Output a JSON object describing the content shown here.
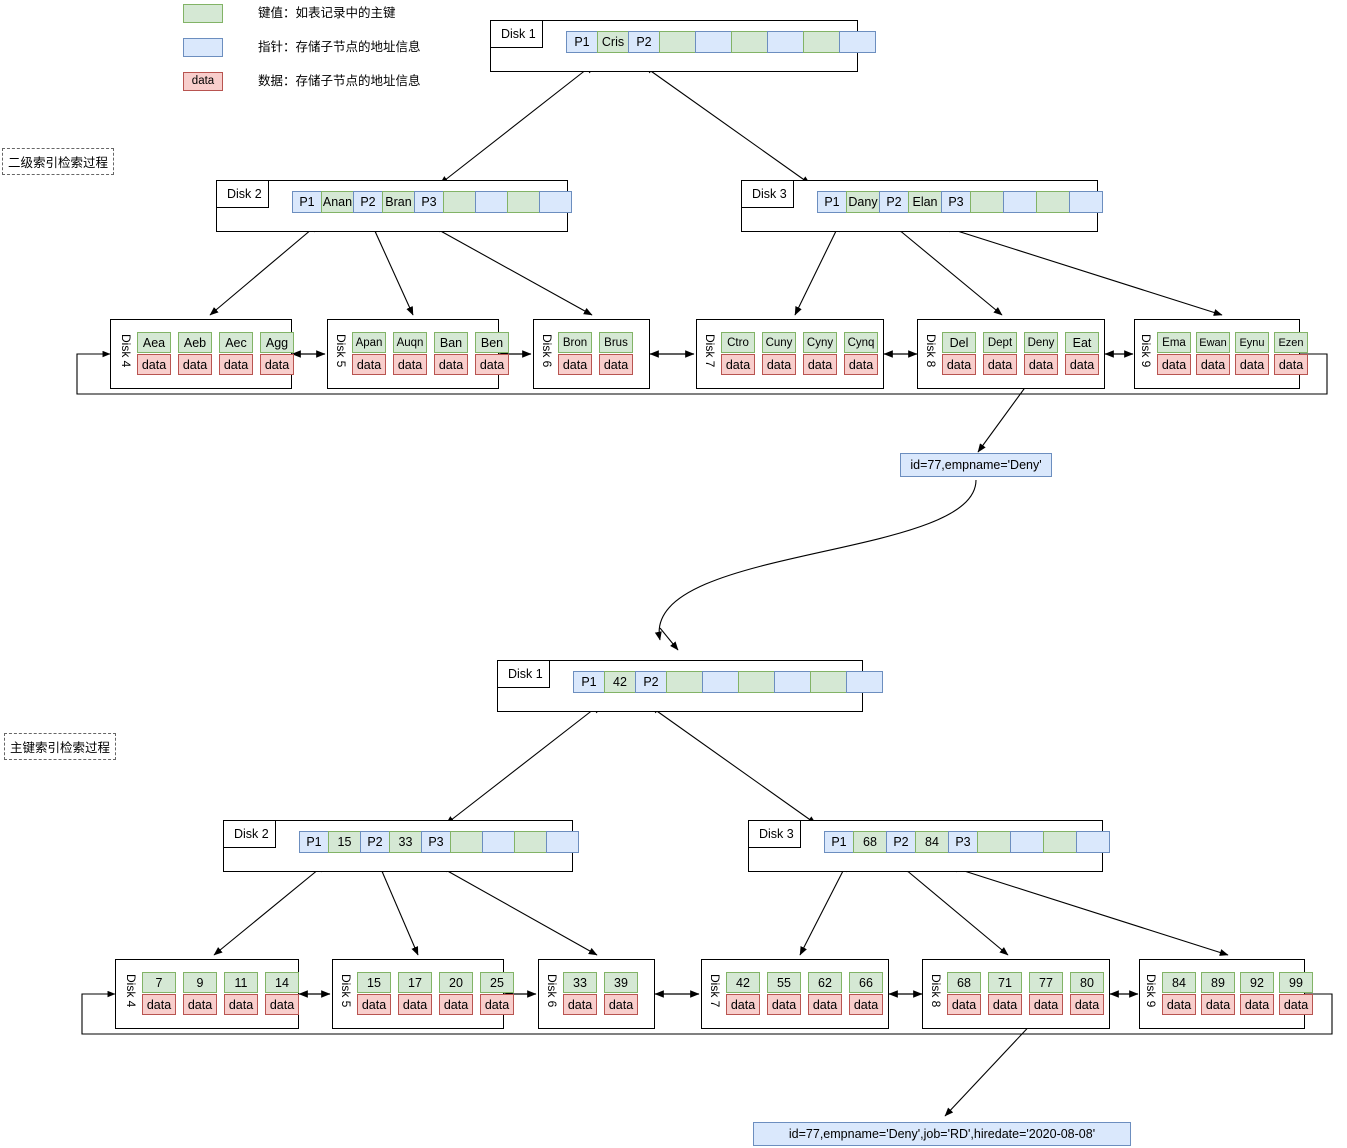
{
  "legend": {
    "items": [
      {
        "swatch": "key",
        "text": "键值：如表记录中的主键",
        "label": ""
      },
      {
        "swatch": "pointer",
        "text": "指针：存储子节点的地址信息",
        "label": ""
      },
      {
        "swatch": "data",
        "text": "数据：存储子节点的地址信息",
        "label": "data"
      }
    ]
  },
  "sections": {
    "secondary": "二级索引检索过程",
    "primary": "主键索引检索过程"
  },
  "colors": {
    "key_fill": "#d5e8d4",
    "key_stroke": "#82b366",
    "pointer_fill": "#dae8fc",
    "pointer_stroke": "#6c8ebf",
    "data_fill": "#f8cecc",
    "data_stroke": "#b85450",
    "node_stroke": "#000000"
  },
  "secondary_tree": {
    "root": {
      "disk": "Disk 1",
      "cells": [
        {
          "text": "P1",
          "type": "pointer"
        },
        {
          "text": "Cris",
          "type": "key"
        },
        {
          "text": "P2",
          "type": "pointer"
        },
        {
          "text": "",
          "type": "key"
        },
        {
          "text": "",
          "type": "pointer"
        },
        {
          "text": "",
          "type": "key"
        },
        {
          "text": "",
          "type": "pointer"
        },
        {
          "text": "",
          "type": "key"
        },
        {
          "text": "",
          "type": "pointer"
        }
      ]
    },
    "internal": [
      {
        "disk": "Disk 2",
        "cells": [
          {
            "text": "P1",
            "type": "pointer"
          },
          {
            "text": "Anan",
            "type": "key"
          },
          {
            "text": "P2",
            "type": "pointer"
          },
          {
            "text": "Bran",
            "type": "key"
          },
          {
            "text": "P3",
            "type": "pointer"
          },
          {
            "text": "",
            "type": "key"
          },
          {
            "text": "",
            "type": "pointer"
          },
          {
            "text": "",
            "type": "key"
          },
          {
            "text": "",
            "type": "pointer"
          }
        ]
      },
      {
        "disk": "Disk 3",
        "cells": [
          {
            "text": "P1",
            "type": "pointer"
          },
          {
            "text": "Dany",
            "type": "key"
          },
          {
            "text": "P2",
            "type": "pointer"
          },
          {
            "text": "Elan",
            "type": "key"
          },
          {
            "text": "P3",
            "type": "pointer"
          },
          {
            "text": "",
            "type": "key"
          },
          {
            "text": "",
            "type": "pointer"
          },
          {
            "text": "",
            "type": "key"
          },
          {
            "text": "",
            "type": "pointer"
          }
        ]
      }
    ],
    "leaves": [
      {
        "disk": "Disk 4",
        "keys": [
          "Aea",
          "Aeb",
          "Aec",
          "Agg"
        ],
        "data_label": "data"
      },
      {
        "disk": "Disk 5",
        "keys": [
          "Apan",
          "Auqn",
          "Ban",
          "Ben"
        ],
        "data_label": "data"
      },
      {
        "disk": "Disk 6",
        "keys": [
          "Bron",
          "Brus"
        ],
        "data_label": "data"
      },
      {
        "disk": "Disk 7",
        "keys": [
          "Ctro",
          "Cuny",
          "Cyny",
          "Cynq"
        ],
        "data_label": "data"
      },
      {
        "disk": "Disk 8",
        "keys": [
          "Del",
          "Dept",
          "Deny",
          "Eat"
        ],
        "data_label": "data"
      },
      {
        "disk": "Disk 9",
        "keys": [
          "Ema",
          "Ewan",
          "Eynu",
          "Ezen"
        ],
        "data_label": "data"
      }
    ],
    "callout": "id=77,empname='Deny'"
  },
  "primary_tree": {
    "root": {
      "disk": "Disk 1",
      "cells": [
        {
          "text": "P1",
          "type": "pointer"
        },
        {
          "text": "42",
          "type": "key"
        },
        {
          "text": "P2",
          "type": "pointer"
        },
        {
          "text": "",
          "type": "key"
        },
        {
          "text": "",
          "type": "pointer"
        },
        {
          "text": "",
          "type": "key"
        },
        {
          "text": "",
          "type": "pointer"
        },
        {
          "text": "",
          "type": "key"
        },
        {
          "text": "",
          "type": "pointer"
        }
      ]
    },
    "internal": [
      {
        "disk": "Disk 2",
        "cells": [
          {
            "text": "P1",
            "type": "pointer"
          },
          {
            "text": "15",
            "type": "key"
          },
          {
            "text": "P2",
            "type": "pointer"
          },
          {
            "text": "33",
            "type": "key"
          },
          {
            "text": "P3",
            "type": "pointer"
          },
          {
            "text": "",
            "type": "key"
          },
          {
            "text": "",
            "type": "pointer"
          },
          {
            "text": "",
            "type": "key"
          },
          {
            "text": "",
            "type": "pointer"
          }
        ]
      },
      {
        "disk": "Disk 3",
        "cells": [
          {
            "text": "P1",
            "type": "pointer"
          },
          {
            "text": "68",
            "type": "key"
          },
          {
            "text": "P2",
            "type": "pointer"
          },
          {
            "text": "84",
            "type": "key"
          },
          {
            "text": "P3",
            "type": "pointer"
          },
          {
            "text": "",
            "type": "key"
          },
          {
            "text": "",
            "type": "pointer"
          },
          {
            "text": "",
            "type": "key"
          },
          {
            "text": "",
            "type": "pointer"
          }
        ]
      }
    ],
    "leaves": [
      {
        "disk": "Disk 4",
        "keys": [
          "7",
          "9",
          "11",
          "14"
        ],
        "data_label": "data"
      },
      {
        "disk": "Disk 5",
        "keys": [
          "15",
          "17",
          "20",
          "25"
        ],
        "data_label": "data"
      },
      {
        "disk": "Disk 6",
        "keys": [
          "33",
          "39"
        ],
        "data_label": "data"
      },
      {
        "disk": "Disk 7",
        "keys": [
          "42",
          "55",
          "62",
          "66"
        ],
        "data_label": "data"
      },
      {
        "disk": "Disk 8",
        "keys": [
          "68",
          "71",
          "77",
          "80"
        ],
        "data_label": "data"
      },
      {
        "disk": "Disk 9",
        "keys": [
          "84",
          "89",
          "92",
          "99"
        ],
        "data_label": "data"
      }
    ],
    "callout": "id=77,empname='Deny',job='RD',hiredate='2020-08-08'"
  }
}
